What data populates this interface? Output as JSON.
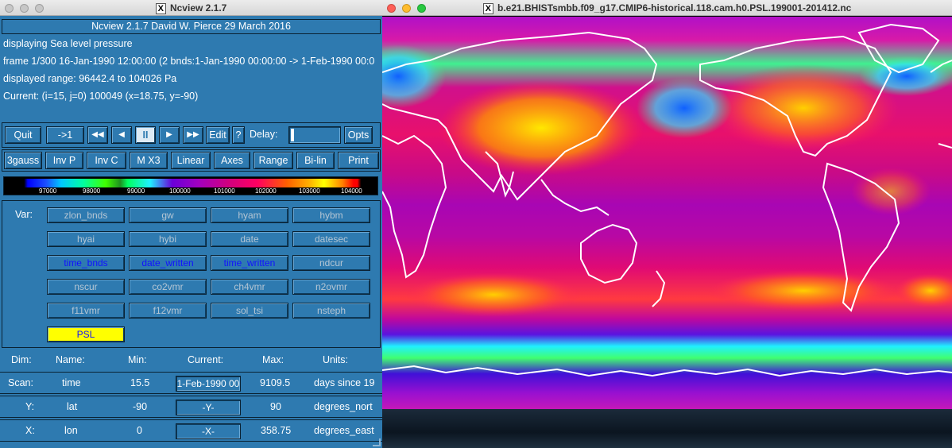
{
  "left_window": {
    "title": "Ncview 2.1.7",
    "header": "Ncview 2.1.7 David W. Pierce  29 March 2016",
    "info_lines": [
      "displaying Sea level pressure",
      "frame 1/300 16-Jan-1990 12:00:00 (2 bnds:1-Jan-1990 00:00:00 -> 1-Feb-1990 00:0",
      "displayed range: 96442.4 to 104026 Pa",
      "Current: (i=15, j=0) 100049 (x=18.75, y=-90)"
    ],
    "controls": {
      "quit": "Quit",
      "step": "->1",
      "rewind": "◀◀",
      "back": "◀",
      "pause": "II",
      "forward": "▶",
      "fast_forward": "▶▶",
      "edit": "Edit",
      "help": "?",
      "delay_label": "Delay:",
      "delay_value": 0.02,
      "opts": "Opts"
    },
    "options": [
      "3gauss",
      "Inv P",
      "Inv C",
      "M X3",
      "Linear",
      "Axes",
      "Range",
      "Bi-lin",
      "Print"
    ],
    "colorbar_ticks": [
      "97000",
      "98000",
      "99000",
      "100000",
      "101000",
      "102000",
      "103000",
      "104000"
    ],
    "var_label": "Var:",
    "variables": [
      [
        "zlon_bnds",
        "gw",
        "hyam",
        "hybm"
      ],
      [
        "hyai",
        "hybi",
        "date",
        "datesec"
      ],
      [
        "time_bnds",
        "date_written",
        "time_written",
        "ndcur"
      ],
      [
        "nscur",
        "co2vmr",
        "ch4vmr",
        "n2ovmr"
      ],
      [
        "f11vmr",
        "f12vmr",
        "sol_tsi",
        "nsteph"
      ]
    ],
    "selected_var": "PSL",
    "dim_headers": [
      "Dim:",
      "Name:",
      "Min:",
      "Current:",
      "Max:",
      "Units:"
    ],
    "dims": [
      {
        "dim": "Scan:",
        "name": "time",
        "min": "15.5",
        "current": "1-Feb-1990 00",
        "max": "9109.5",
        "units": "days since 19"
      },
      {
        "dim": "Y:",
        "name": "lat",
        "min": "-90",
        "current": "-Y-",
        "max": "90",
        "units": "degrees_nort"
      },
      {
        "dim": "X:",
        "name": "lon",
        "min": "0",
        "current": "-X-",
        "max": "358.75",
        "units": "degrees_east"
      }
    ]
  },
  "right_window": {
    "title": "b.e21.BHISTsmbb.f09_g17.CMIP6-historical.118.cam.h0.PSL.199001-201412.nc"
  },
  "colors": {
    "panel": "#2e7ab0",
    "selected": "#ffff00",
    "var_blue": "#1212ff"
  }
}
